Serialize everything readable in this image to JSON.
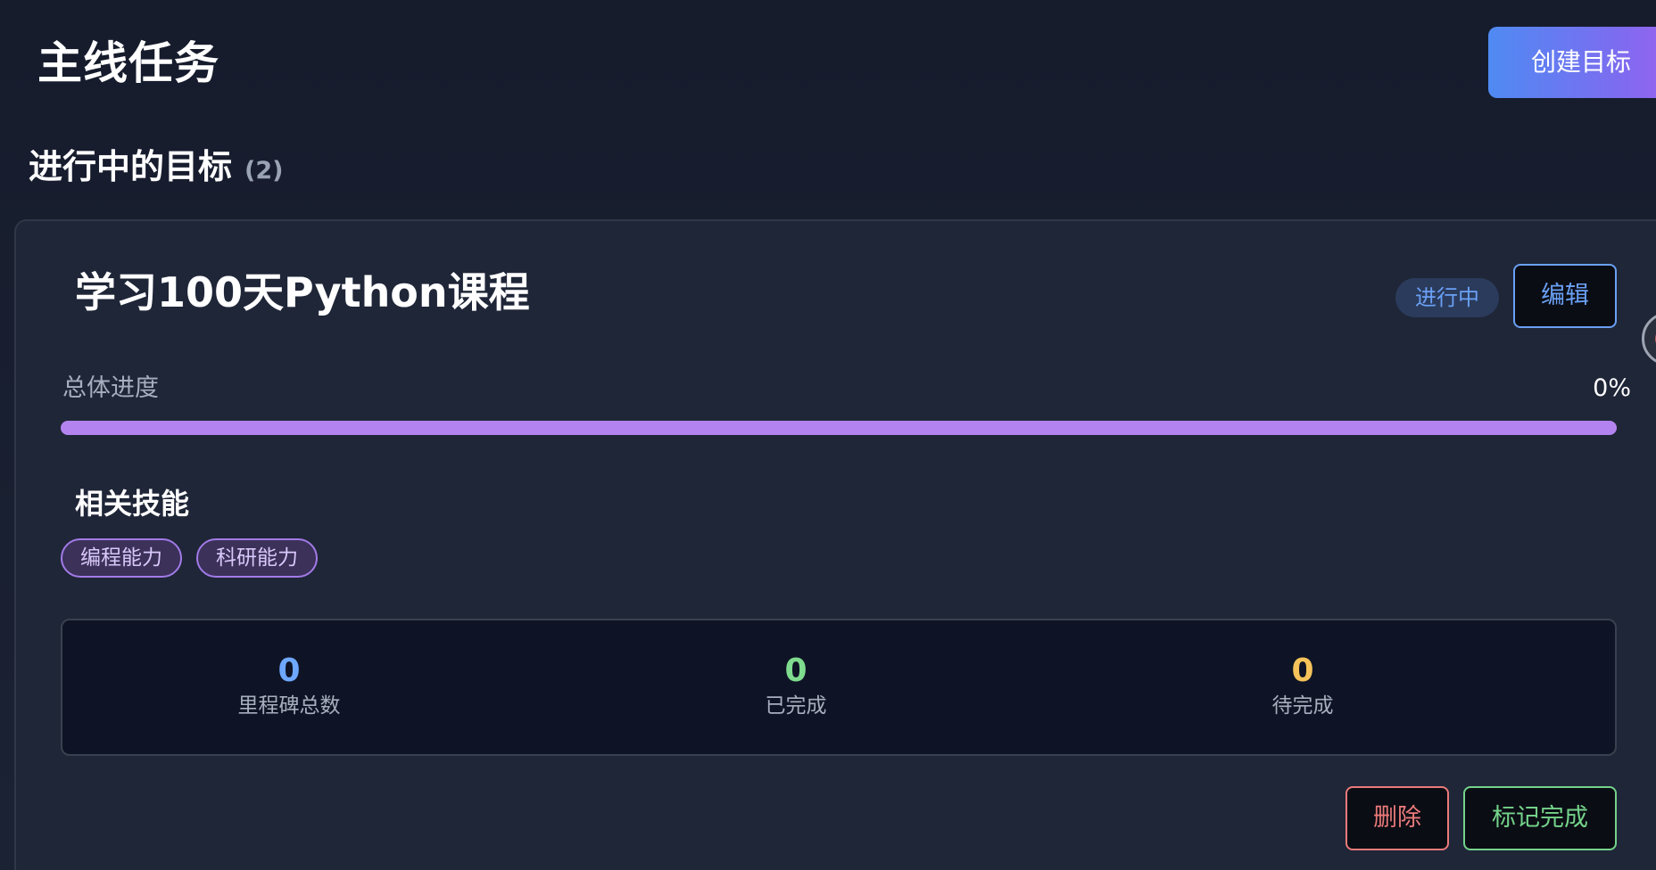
{
  "header": {
    "title": "主线任务",
    "create_label": "创建目标"
  },
  "section": {
    "title": "进行中的目标",
    "count": "(2)"
  },
  "goal": {
    "title": "学习100天Python课程",
    "status": "进行中",
    "edit_label": "编辑",
    "progress_label": "总体进度",
    "progress_text": "0%",
    "progress_percent": 0,
    "skills_title": "相关技能",
    "skills": [
      "编程能力",
      "科研能力"
    ],
    "stats": [
      {
        "value": "0",
        "label": "里程碑总数",
        "color": "#6ea8fe"
      },
      {
        "value": "0",
        "label": "已完成",
        "color": "#7fdc8e"
      },
      {
        "value": "0",
        "label": "待完成",
        "color": "#f5c35a"
      }
    ],
    "delete_label": "删除",
    "complete_label": "标记完成"
  },
  "colors": {
    "accent_blue": "#4f8af2",
    "accent_purple": "#9a62ee",
    "danger": "#ea7a7a",
    "success": "#74d38a"
  }
}
